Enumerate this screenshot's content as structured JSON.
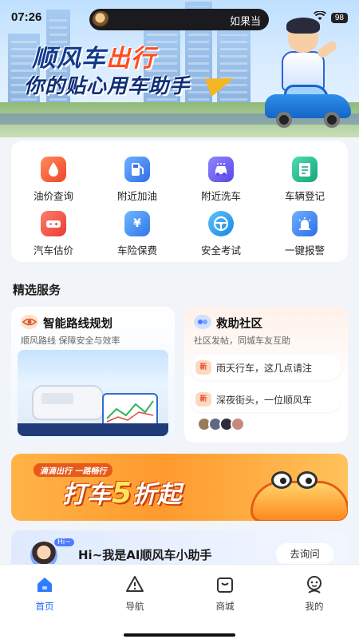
{
  "status_bar": {
    "time": "07:26",
    "notification": "如果当",
    "battery": "98"
  },
  "banner": {
    "title_main": "顺风车",
    "title_highlight": "出行",
    "subtitle": "你的贴心用车助手"
  },
  "services": [
    {
      "label": "油价查询",
      "icon": "oil-price-icon",
      "color": "#f0613c"
    },
    {
      "label": "附近加油",
      "icon": "fuel-station-icon",
      "color": "#3b7cf0"
    },
    {
      "label": "附近洗车",
      "icon": "car-wash-icon",
      "color": "#6a5cf2"
    },
    {
      "label": "车辆登记",
      "icon": "registration-icon",
      "color": "#21b98a"
    },
    {
      "label": "汽车估价",
      "icon": "car-valuation-icon",
      "color": "#f05a4c"
    },
    {
      "label": "车险保费",
      "icon": "insurance-icon",
      "color": "#3a8cf0"
    },
    {
      "label": "安全考试",
      "icon": "steering-wheel-icon",
      "color": "#2f9be8"
    },
    {
      "label": "一键报警",
      "icon": "alarm-icon",
      "color": "#3b7cf0"
    }
  ],
  "featured": {
    "section_title": "精选服务",
    "route": {
      "title": "智能路线规划",
      "subtitle": "顺风路线 保障安全与效率"
    },
    "community": {
      "title": "救助社区",
      "subtitle": "社区发帖，同城车友互助",
      "posts": [
        {
          "badge": "新",
          "text": "雨天行车，这几点请注"
        },
        {
          "badge": "新",
          "text": "深夜街头，一位顺风车"
        }
      ]
    }
  },
  "promo": {
    "tag": "滴滴出行 一路畅行",
    "text_before": "打车",
    "text_big": "5",
    "text_after": "折起"
  },
  "assistant": {
    "hi_badge": "Hi~",
    "text": "Hi~我是AI顺风车小助手",
    "button": "去询问"
  },
  "bottom_nav": [
    {
      "label": "首页",
      "icon": "home-icon",
      "active": true
    },
    {
      "label": "导航",
      "icon": "navigation-icon",
      "active": false
    },
    {
      "label": "商城",
      "icon": "shop-icon",
      "active": false
    },
    {
      "label": "我的",
      "icon": "profile-icon",
      "active": false
    }
  ],
  "colors": {
    "accent": "#1f6bff",
    "banner_title": "#123a8c",
    "highlight": "#ff4d21",
    "promo": "#ff9a2e"
  }
}
